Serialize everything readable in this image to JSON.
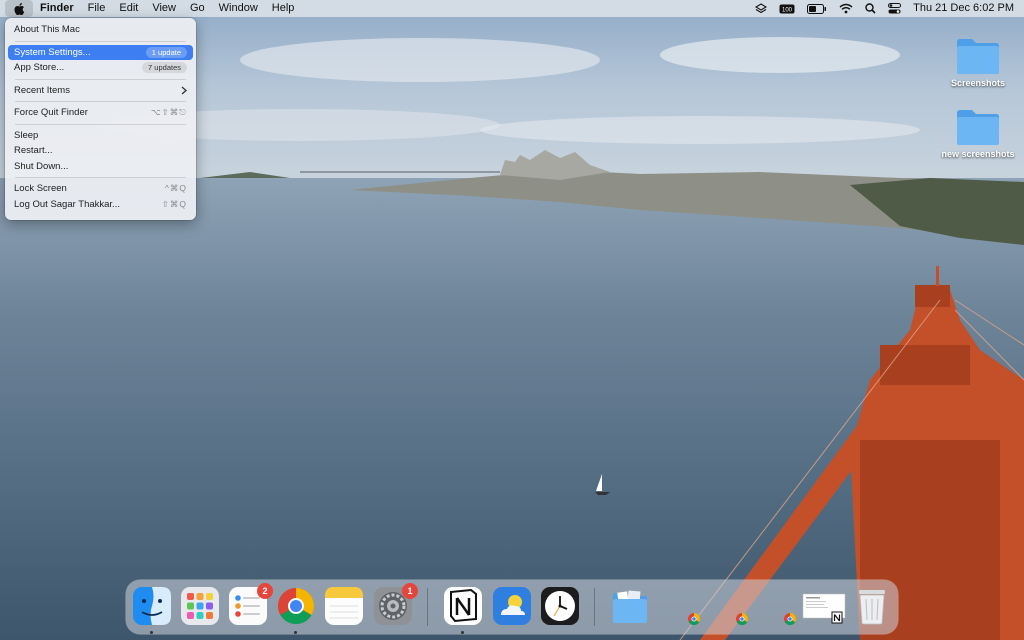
{
  "menubar": {
    "apple_icon": "apple-logo-icon",
    "app_name": "Finder",
    "items": [
      "File",
      "Edit",
      "View",
      "Go",
      "Window",
      "Help"
    ],
    "status_icons": [
      "focus-icon",
      "battery-percent-icon",
      "battery-icon",
      "wifi-icon",
      "spotlight-search-icon",
      "control-center-icon"
    ],
    "datetime": "Thu 21 Dec  6:02 PM"
  },
  "apple_menu": {
    "about": "About This Mac",
    "system_settings": "System Settings...",
    "system_settings_badge": "1 update",
    "app_store": "App Store...",
    "app_store_badge": "7 updates",
    "recent_items": "Recent Items",
    "force_quit": "Force Quit Finder",
    "force_quit_shortcut": "⌥⇧⌘⎋",
    "sleep": "Sleep",
    "restart": "Restart...",
    "shut_down": "Shut Down...",
    "lock_screen": "Lock Screen",
    "lock_screen_shortcut": "^⌘Q",
    "log_out": "Log Out Sagar Thakkar...",
    "log_out_shortcut": "⇧⌘Q"
  },
  "desktop": {
    "folders": [
      "Screenshots",
      "new screenshots"
    ]
  },
  "dock": {
    "apps": [
      {
        "name": "Finder",
        "icon": "finder-icon",
        "running": true
      },
      {
        "name": "Launchpad",
        "icon": "launchpad-icon",
        "running": false
      },
      {
        "name": "Reminders",
        "icon": "reminders-icon",
        "badge": "2",
        "running": false
      },
      {
        "name": "Google Chrome",
        "icon": "chrome-icon",
        "running": true
      },
      {
        "name": "Notes",
        "icon": "notes-icon",
        "running": false
      },
      {
        "name": "System Settings",
        "icon": "system-settings-icon",
        "badge": "1",
        "running": false
      },
      {
        "name": "Notion",
        "icon": "notion-icon",
        "running": true
      },
      {
        "name": "Weather",
        "icon": "weather-icon",
        "running": false
      },
      {
        "name": "Clock",
        "icon": "clock-icon",
        "running": false
      }
    ],
    "stacks": [
      "downloads-folder-icon",
      "minimized-chrome-icon",
      "minimized-chrome-icon",
      "minimized-chrome-icon",
      "minimized-notion-window-icon",
      "trash-icon"
    ],
    "colors": {
      "badge": "#e5453b",
      "highlight": "#3d7ff3",
      "folder": "#5aaaf0"
    }
  }
}
